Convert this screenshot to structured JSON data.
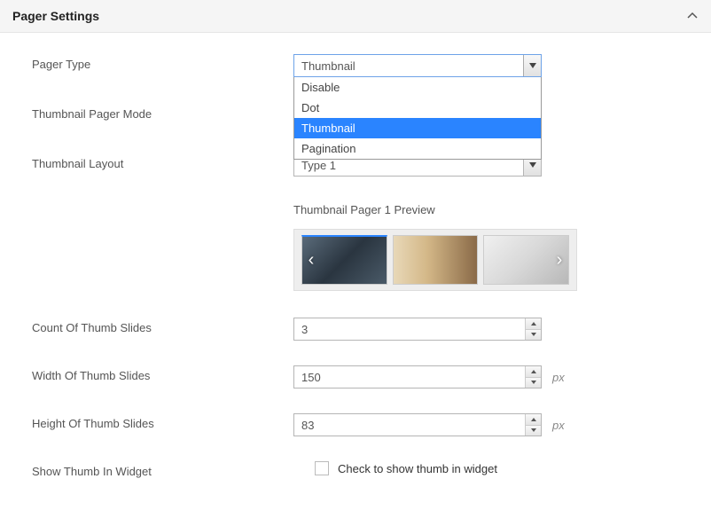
{
  "header": {
    "title": "Pager Settings"
  },
  "labels": {
    "pager_type": "Pager Type",
    "thumb_mode": "Thumbnail Pager Mode",
    "thumb_layout": "Thumbnail Layout",
    "count_slides": "Count Of Thumb Slides",
    "width_slides": "Width Of Thumb Slides",
    "height_slides": "Height Of Thumb Slides",
    "show_widget": "Show Thumb In Widget"
  },
  "pager_type": {
    "value": "Thumbnail",
    "options": [
      "Disable",
      "Dot",
      "Thumbnail",
      "Pagination"
    ],
    "selected_index": 2
  },
  "thumb_layout": {
    "value": "Type 1"
  },
  "preview": {
    "title": "Thumbnail Pager 1 Preview"
  },
  "count": {
    "value": "3"
  },
  "width": {
    "value": "150",
    "unit": "px"
  },
  "height": {
    "value": "83",
    "unit": "px"
  },
  "widget": {
    "label": "Check to show thumb in widget"
  }
}
